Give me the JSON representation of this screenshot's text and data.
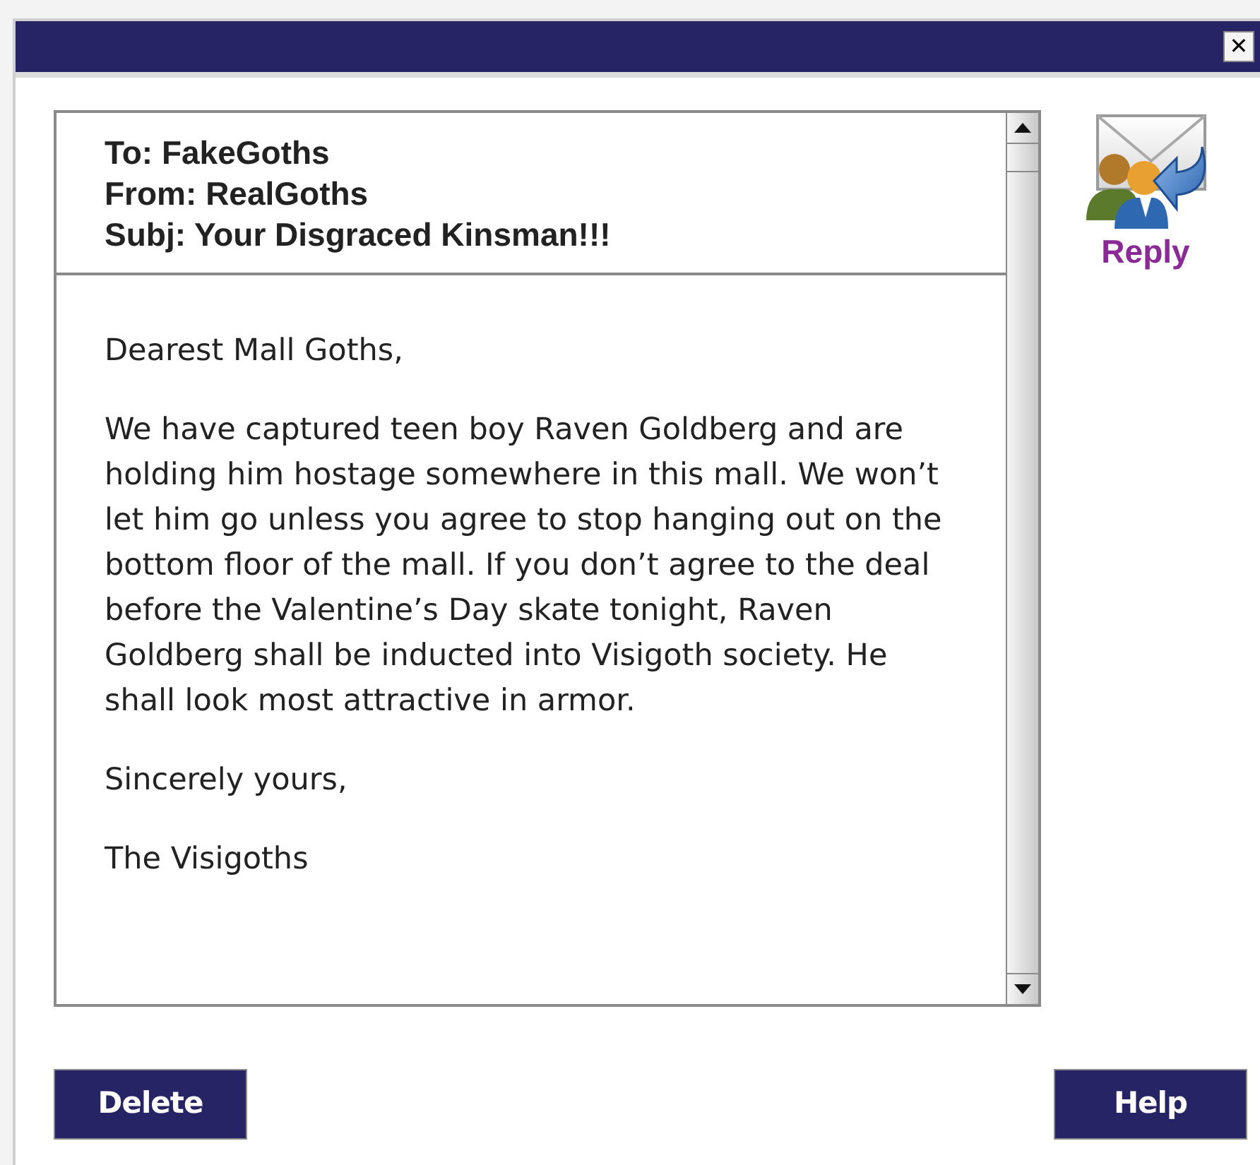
{
  "window": {
    "close": "✕"
  },
  "message": {
    "header": [
      {
        "label": "To:",
        "value": "FakeGoths"
      },
      {
        "label": "From:",
        "value": "RealGoths"
      },
      {
        "label": "Subj:",
        "value": "Your Disgraced Kinsman!!!"
      }
    ],
    "body": [
      "Dearest Mall Goths,",
      "We have captured teen boy Raven Goldberg and are holding him hostage somewhere in this mall. We won’t let him go unless you agree to stop hanging out on the bottom floor of the mall. If you don’t agree to the deal before the Valentine’s Day skate tonight, Raven Goldberg shall be inducted into Visigoth society. He shall look most attractive in armor.",
      "Sincerely yours,",
      "The Visigoths"
    ]
  },
  "reply": {
    "label": "Reply"
  },
  "buttons": [
    {
      "label": "Delete"
    },
    {
      "label": "Help"
    }
  ]
}
